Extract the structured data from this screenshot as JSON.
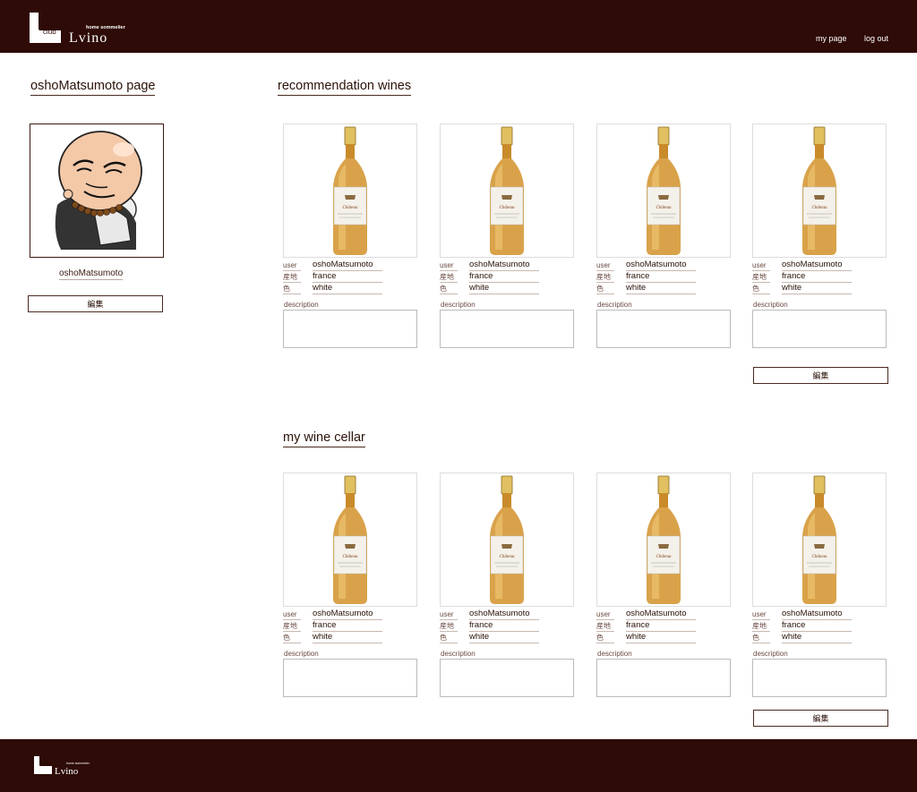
{
  "header": {
    "logo_club": "club",
    "logo_tagline": "home sommelier",
    "logo_name": "Lvino",
    "nav": {
      "my_page": "my page",
      "log_out": "log out"
    }
  },
  "profile": {
    "page_title": "oshoMatsumoto page",
    "name": "oshoMatsumoto",
    "edit_label": "編集"
  },
  "recommendations": {
    "title": "recommendation wines",
    "edit_label": "編集",
    "wines": [
      {
        "user_label": "user",
        "user": "oshoMatsumoto",
        "origin_label": "産地",
        "origin": "france",
        "color_label": "色",
        "color": "white",
        "description_label": "description",
        "description": ""
      },
      {
        "user_label": "user",
        "user": "oshoMatsumoto",
        "origin_label": "産地",
        "origin": "france",
        "color_label": "色",
        "color": "white",
        "description_label": "description",
        "description": ""
      },
      {
        "user_label": "user",
        "user": "oshoMatsumoto",
        "origin_label": "産地",
        "origin": "france",
        "color_label": "色",
        "color": "white",
        "description_label": "description",
        "description": ""
      },
      {
        "user_label": "user",
        "user": "oshoMatsumoto",
        "origin_label": "産地",
        "origin": "france",
        "color_label": "色",
        "color": "white",
        "description_label": "description",
        "description": ""
      }
    ]
  },
  "cellar": {
    "title": "my wine cellar",
    "edit_label": "編集",
    "wines": [
      {
        "user_label": "user",
        "user": "oshoMatsumoto",
        "origin_label": "産地",
        "origin": "france",
        "color_label": "色",
        "color": "white",
        "description_label": "description",
        "description": ""
      },
      {
        "user_label": "user",
        "user": "oshoMatsumoto",
        "origin_label": "産地",
        "origin": "france",
        "color_label": "色",
        "color": "white",
        "description_label": "description",
        "description": ""
      },
      {
        "user_label": "user",
        "user": "oshoMatsumoto",
        "origin_label": "産地",
        "origin": "france",
        "color_label": "色",
        "color": "white",
        "description_label": "description",
        "description": ""
      },
      {
        "user_label": "user",
        "user": "oshoMatsumoto",
        "origin_label": "産地",
        "origin": "france",
        "color_label": "色",
        "color": "white",
        "description_label": "description",
        "description": ""
      }
    ]
  },
  "footer": {
    "logo_tagline": "home sommelier",
    "logo_name": "Lvino"
  },
  "colors": {
    "brand_dark": "#2e0b06",
    "text": "#3a1a10",
    "wine": "#d9a24a"
  }
}
